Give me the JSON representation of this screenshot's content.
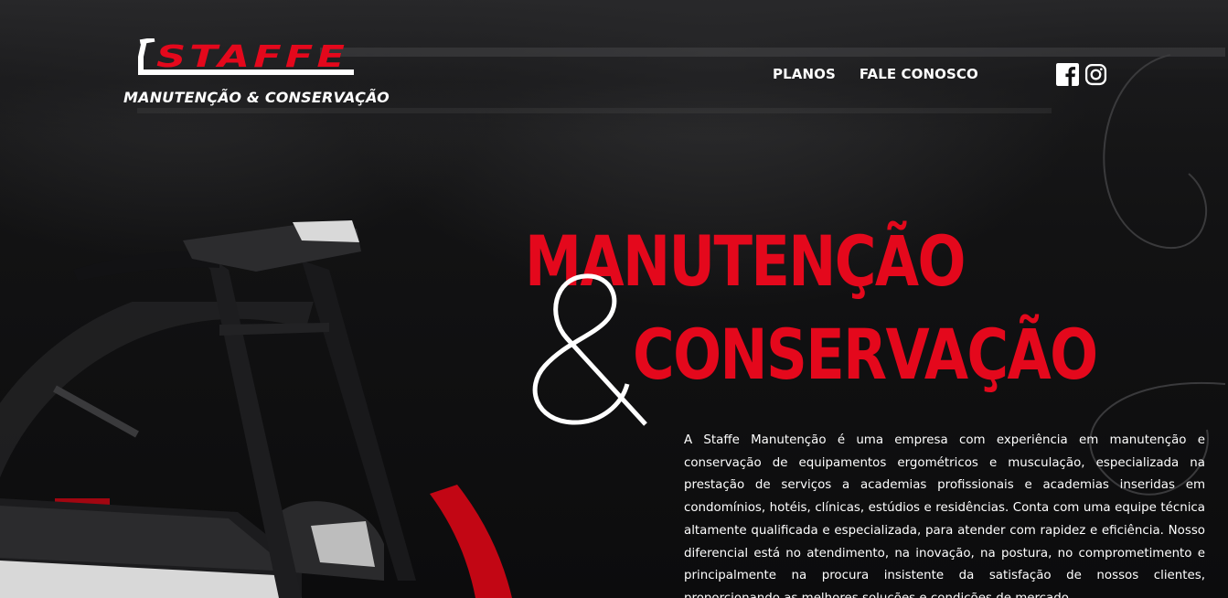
{
  "brand": {
    "logo_text": "STAFFE",
    "tagline": "MANUTENÇÃO & CONSERVAÇÃO",
    "color": "#e4081c"
  },
  "nav": {
    "items": [
      {
        "label": "PLANOS"
      },
      {
        "label": "FALE CONOSCO"
      }
    ]
  },
  "social": {
    "icons": [
      "facebook-icon",
      "instagram-icon"
    ]
  },
  "hero": {
    "headline_line1": "MANUTENÇÃO",
    "ampersand": "&",
    "headline_line2": "CONSERVAÇÃO",
    "description": "A Staffe Manutenção é uma empresa com experiência em manutenção e conservação de equipamentos ergométricos e musculação, especializada na prestação de serviços a academias profissionais e academias inseridas em condomínios, hotéis, clínicas, estúdios e residências. Conta com uma equipe técnica altamente qualificada e especializada, para atender com rapidez e eficiência. Nosso diferencial está no atendimento, na inovação, na postura, no comprometimento e principalmente na procura insistente da satisfação de nossos clientes, proporcionando as melhores soluções e condições de mercado."
  },
  "colors": {
    "accent": "#e4081c",
    "background": "#0f0f10",
    "text": "#ffffff"
  }
}
